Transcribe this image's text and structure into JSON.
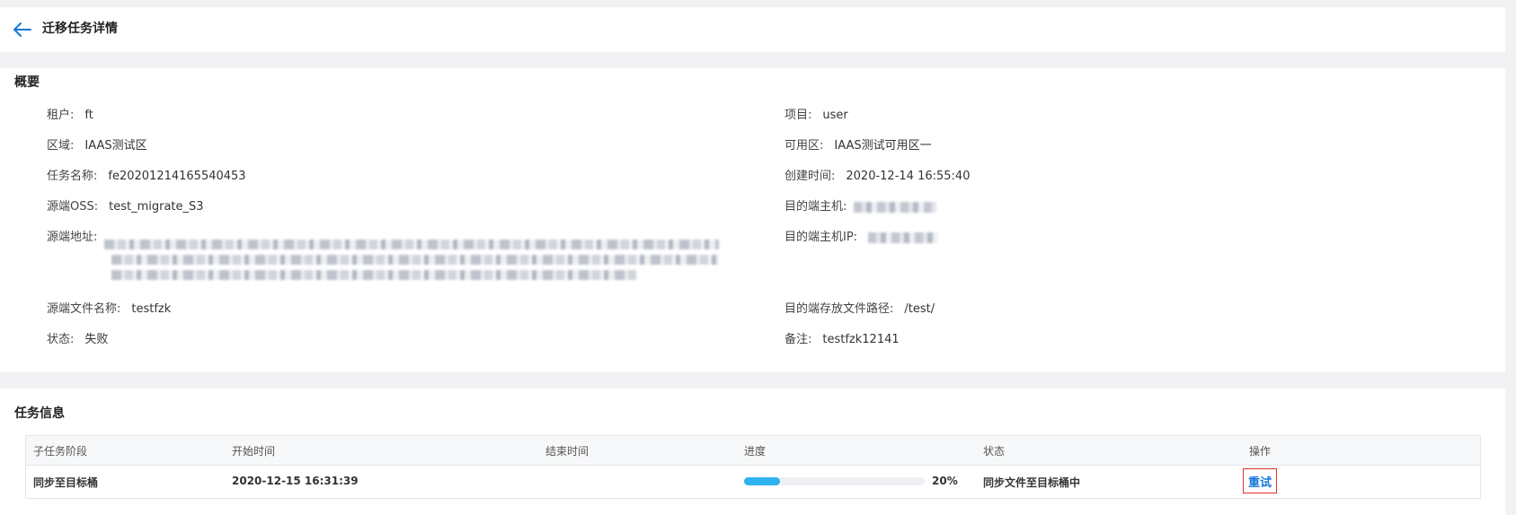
{
  "header": {
    "title": "迁移任务详情"
  },
  "overview": {
    "title": "概要",
    "left": [
      {
        "label": "租户:",
        "value": "ft"
      },
      {
        "label": "区域:",
        "value": "IAAS测试区"
      },
      {
        "label": "任务名称:",
        "value": "fe20201214165540453"
      },
      {
        "label": "源端OSS:",
        "value": "test_migrate_S3"
      },
      {
        "label": "源端地址:",
        "value": ""
      },
      {
        "label": "源端文件名称:",
        "value": "testfzk"
      },
      {
        "label": "状态:",
        "value": "失败"
      }
    ],
    "right": [
      {
        "label": "项目:",
        "value": "user"
      },
      {
        "label": "可用区:",
        "value": "IAAS测试可用区一"
      },
      {
        "label": "创建时间:",
        "value": "2020-12-14 16:55:40"
      },
      {
        "label": "目的端主机:",
        "value": ""
      },
      {
        "label": "目的端主机IP:",
        "value": ""
      },
      {
        "label": "目的端存放文件路径:",
        "value": "/test/"
      },
      {
        "label": "备注:",
        "value": "testfzk12141"
      }
    ]
  },
  "task_info": {
    "title": "任务信息",
    "columns": [
      "子任务阶段",
      "开始时间",
      "结束时间",
      "进度",
      "状态",
      "操作"
    ],
    "rows": [
      {
        "stage": "同步至目标桶",
        "start_time": "2020-12-15 16:31:39",
        "end_time": "",
        "progress": 0.2,
        "progress_label": "20%",
        "status": "同步文件至目标桶中",
        "action": "重试"
      }
    ]
  },
  "colors": {
    "accent": "#1677d9",
    "progress": "#2fb3ee",
    "highlight": "#e0302c"
  },
  "icons": {
    "back": "arrow-left-icon"
  }
}
